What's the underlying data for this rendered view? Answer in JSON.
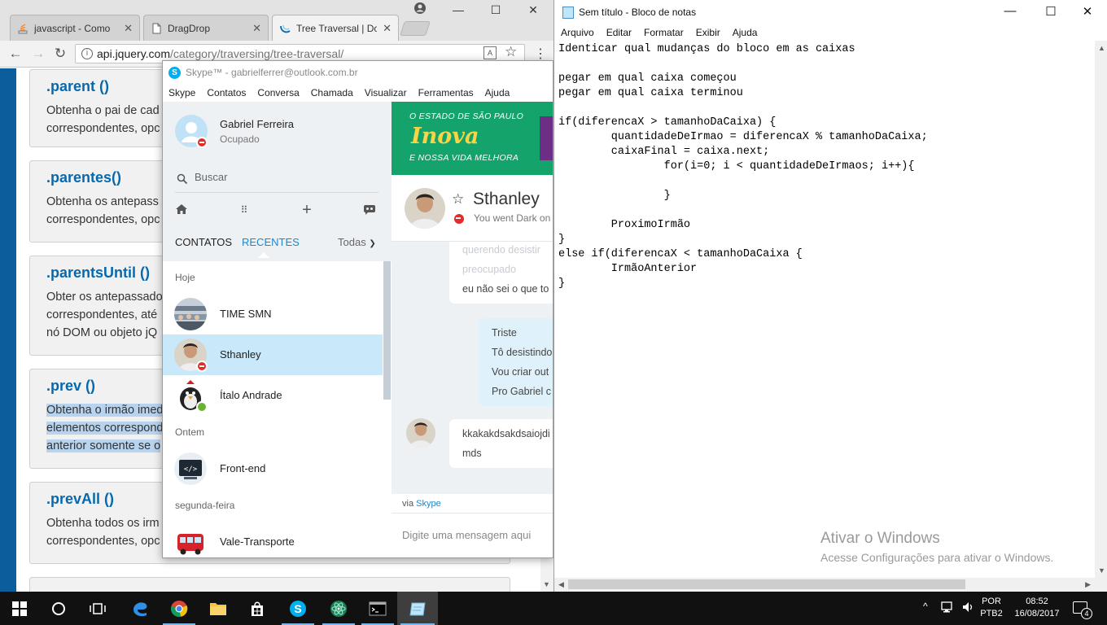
{
  "chrome": {
    "tabs": [
      {
        "title": "javascript - Como",
        "favicon": "stackoverflow-icon"
      },
      {
        "title": "DragDrop",
        "favicon": "page-icon"
      },
      {
        "title": "Tree Traversal | Do",
        "favicon": "jquery-icon"
      }
    ],
    "url_domain": "api.jquery.com",
    "url_path": "/category/traversing/tree-traversal/",
    "lock_glyph": "i"
  },
  "jquery": {
    "entries": [
      {
        "title": ".parent ()",
        "lines": [
          "Obtenha o pai de cad",
          "correspondentes, opc"
        ]
      },
      {
        "title": ".parentes()",
        "lines": [
          "Obtenha os antepass",
          "correspondentes, opc"
        ]
      },
      {
        "title": ".parentsUntil ()",
        "lines": [
          "Obter os antepassado",
          "correspondentes, até",
          "nó DOM ou objeto jQ"
        ]
      },
      {
        "title": ".prev ()",
        "lines": [
          "Obtenha o irmão imed",
          "elementos correspond",
          "anterior somente se o"
        ]
      },
      {
        "title": ".prevAll ()",
        "lines": [
          "Obtenha todos os irm",
          "correspondentes, opc"
        ]
      }
    ]
  },
  "skype": {
    "window_title": "Skype™ - gabrielferrer@outlook.com.br",
    "logo_letter": "S",
    "menu": [
      "Skype",
      "Contatos",
      "Conversa",
      "Chamada",
      "Visualizar",
      "Ferramentas",
      "Ajuda"
    ],
    "profile": {
      "name": "Gabriel Ferreira",
      "status": "Ocupado"
    },
    "search_placeholder": "Buscar",
    "tabs": {
      "contatos": "CONTATOS",
      "recentes": "RECENTES",
      "todas": "Todas"
    },
    "sections": {
      "today": "Hoje",
      "yesterday": "Ontem",
      "monday": "segunda-feira"
    },
    "recents": [
      {
        "name": "TIME SMN",
        "status": "none"
      },
      {
        "name": "Sthanley",
        "status": "busy",
        "selected": true
      },
      {
        "name": "Ítalo Andrade",
        "status": "online"
      },
      {
        "name": "Front-end",
        "status": "none"
      },
      {
        "name": "Vale-Transporte",
        "status": "none"
      }
    ],
    "ad": {
      "line1": "O ESTADO DE SÃO PAULO",
      "line2": "Inova",
      "line3": "E NOSSA VIDA MELHORA"
    },
    "chat": {
      "name": "Sthanley",
      "mood": "You went Dark on",
      "messages_in_1": [
        "querendo desistir",
        "preocupado",
        "eu não sei o que to"
      ],
      "messages_out": [
        "Triste",
        "Tô desistindo",
        "Vou criar out",
        "Pro Gabriel c"
      ],
      "messages_in_2": [
        "kkakakdsakdsaiojdi",
        "mds"
      ],
      "via_prefix": "via",
      "via_link": "Skype",
      "compose_placeholder": "Digite uma mensagem aqui"
    }
  },
  "notepad": {
    "title": "Sem título - Bloco de notas",
    "menu": [
      "Arquivo",
      "Editar",
      "Formatar",
      "Exibir",
      "Ajuda"
    ],
    "content": "Identicar qual mudanças do bloco em as caixas\n\npegar em qual caixa começou\npegar em qual caixa terminou\n\nif(diferencaX > tamanhoDaCaixa) {\n        quantidadeDeIrmao = diferencaX % tamanhoDaCaixa;\n        caixaFinal = caixa.next;\n                for(i=0; i < quantidadeDeIrmaos; i++){\n\n                }\n\n        ProximoIrmão\n}\nelse if(diferencaX < tamanhoDaCaixa {\n        IrmãoAnterior\n}",
    "activate_title": "Ativar o Windows",
    "activate_sub": "Acesse Configurações para ativar o Windows."
  },
  "taskbar": {
    "apps": [
      "start",
      "cortana",
      "task-view",
      "edge",
      "chrome",
      "file-explorer",
      "store",
      "skype",
      "atom",
      "cmd",
      "notepad"
    ],
    "language": "POR",
    "layout": "PTB2",
    "time": "08:52",
    "date": "16/08/2017",
    "notification_count": "4"
  }
}
